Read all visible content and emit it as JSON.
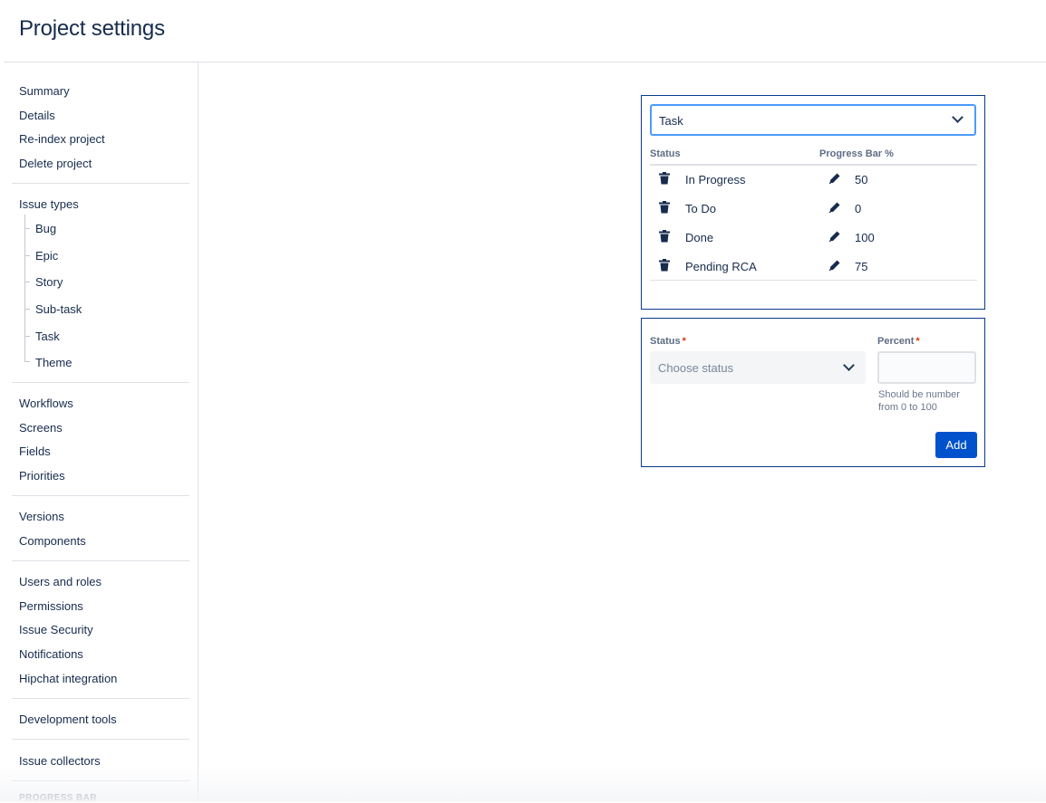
{
  "header": {
    "title": "Project settings"
  },
  "sidebar": {
    "group1": [
      "Summary",
      "Details",
      "Re-index project",
      "Delete project"
    ],
    "issue_types_label": "Issue types",
    "issue_types": [
      "Bug",
      "Epic",
      "Story",
      "Sub-task",
      "Task",
      "Theme"
    ],
    "group3": [
      "Workflows",
      "Screens",
      "Fields",
      "Priorities"
    ],
    "group4": [
      "Versions",
      "Components"
    ],
    "group5": [
      "Users and roles",
      "Permissions",
      "Issue Security",
      "Notifications",
      "Hipchat integration"
    ],
    "group6": [
      "Development tools"
    ],
    "group7": [
      "Issue collectors"
    ],
    "section_heading": "PROGRESS BAR"
  },
  "mapping_panel": {
    "issue_type_select": "Task",
    "col_status": "Status",
    "col_progress": "Progress Bar %",
    "rows": [
      {
        "status": "In Progress",
        "percent": "50"
      },
      {
        "status": "To Do",
        "percent": "0"
      },
      {
        "status": "Done",
        "percent": "100"
      },
      {
        "status": "Pending RCA",
        "percent": "75"
      }
    ]
  },
  "add_panel": {
    "status_label": "Status",
    "percent_label": "Percent",
    "required_mark": "*",
    "status_placeholder": "Choose status",
    "percent_value": "",
    "help_text": "Should be number from 0 to 100",
    "add_label": "Add"
  },
  "colors": {
    "accent": "#0052cc",
    "panel_border": "#0b3a8c",
    "focus": "#4c9aff",
    "required": "#de350b"
  },
  "icons": {
    "delete": "trash-icon",
    "edit": "pencil-icon",
    "dropdown": "chevron-down-icon"
  }
}
